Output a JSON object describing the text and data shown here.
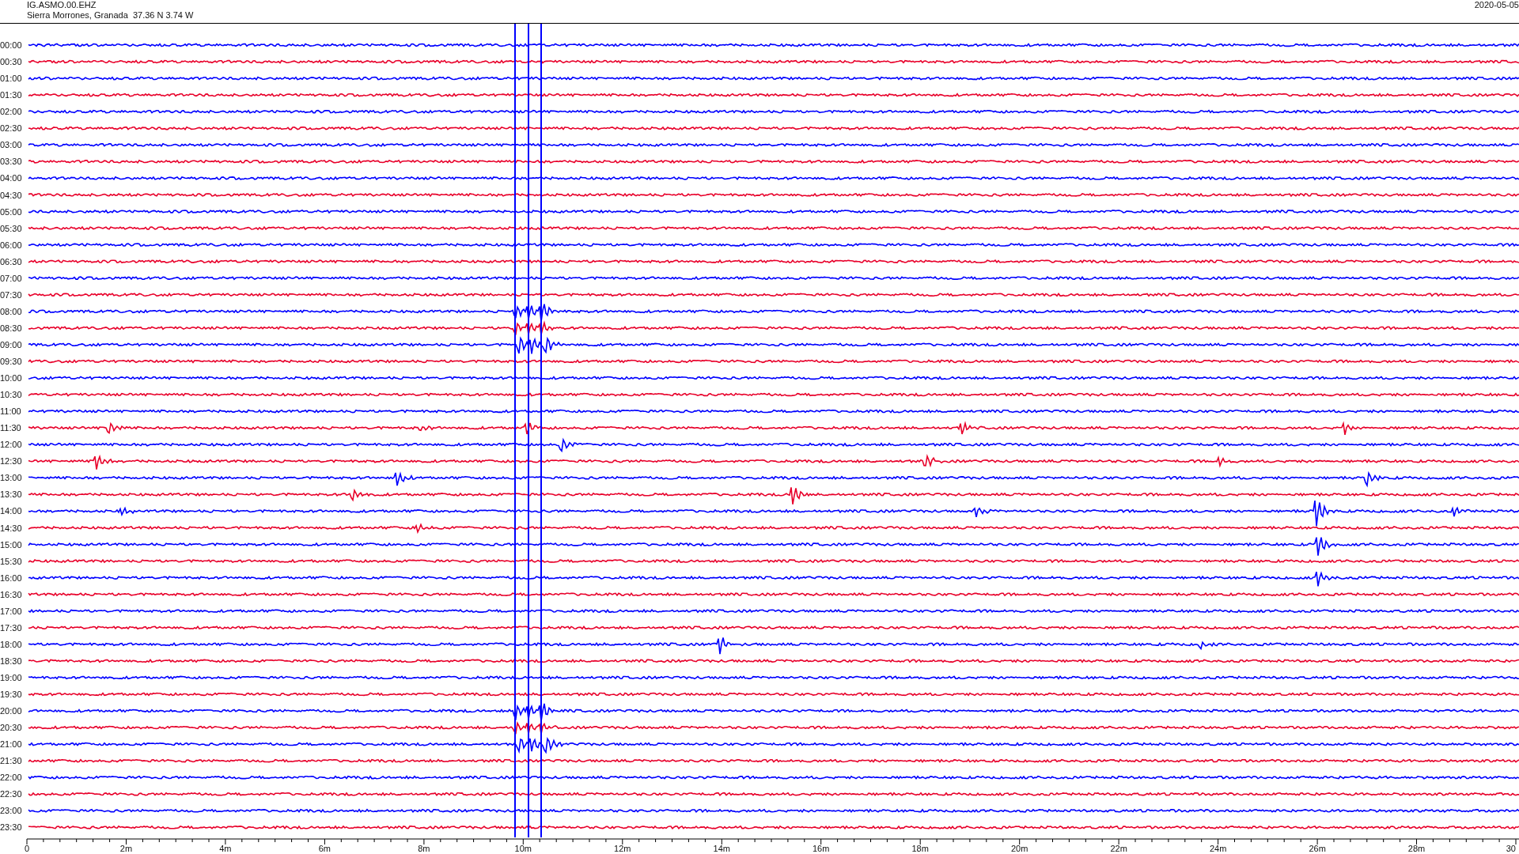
{
  "header": {
    "station": "IG.ASMO.00.EHZ",
    "location": "Sierra Morrones, Granada  37.36 N 3.74 W",
    "date": "2020-05-05"
  },
  "rows": [
    {
      "label": "00:00",
      "color": "#0000ff"
    },
    {
      "label": "00:30",
      "color": "#e8002a"
    },
    {
      "label": "01:00",
      "color": "#0000ff"
    },
    {
      "label": "01:30",
      "color": "#e8002a"
    },
    {
      "label": "02:00",
      "color": "#0000ff"
    },
    {
      "label": "02:30",
      "color": "#e8002a"
    },
    {
      "label": "03:00",
      "color": "#0000ff"
    },
    {
      "label": "03:30",
      "color": "#e8002a"
    },
    {
      "label": "04:00",
      "color": "#0000ff"
    },
    {
      "label": "04:30",
      "color": "#e8002a"
    },
    {
      "label": "05:00",
      "color": "#0000ff"
    },
    {
      "label": "05:30",
      "color": "#e8002a"
    },
    {
      "label": "06:00",
      "color": "#0000ff"
    },
    {
      "label": "06:30",
      "color": "#e8002a"
    },
    {
      "label": "07:00",
      "color": "#0000ff"
    },
    {
      "label": "07:30",
      "color": "#e8002a"
    },
    {
      "label": "08:00",
      "color": "#0000ff"
    },
    {
      "label": "08:30",
      "color": "#e8002a"
    },
    {
      "label": "09:00",
      "color": "#0000ff"
    },
    {
      "label": "09:30",
      "color": "#e8002a"
    },
    {
      "label": "10:00",
      "color": "#0000ff"
    },
    {
      "label": "10:30",
      "color": "#e8002a"
    },
    {
      "label": "11:00",
      "color": "#0000ff"
    },
    {
      "label": "11:30",
      "color": "#e8002a"
    },
    {
      "label": "12:00",
      "color": "#0000ff"
    },
    {
      "label": "12:30",
      "color": "#e8002a"
    },
    {
      "label": "13:00",
      "color": "#0000ff"
    },
    {
      "label": "13:30",
      "color": "#e8002a"
    },
    {
      "label": "14:00",
      "color": "#0000ff"
    },
    {
      "label": "14:30",
      "color": "#e8002a"
    },
    {
      "label": "15:00",
      "color": "#0000ff"
    },
    {
      "label": "15:30",
      "color": "#e8002a"
    },
    {
      "label": "16:00",
      "color": "#0000ff"
    },
    {
      "label": "16:30",
      "color": "#e8002a"
    },
    {
      "label": "17:00",
      "color": "#0000ff"
    },
    {
      "label": "17:30",
      "color": "#e8002a"
    },
    {
      "label": "18:00",
      "color": "#0000ff"
    },
    {
      "label": "18:30",
      "color": "#e8002a"
    },
    {
      "label": "19:00",
      "color": "#0000ff"
    },
    {
      "label": "19:30",
      "color": "#e8002a"
    },
    {
      "label": "20:00",
      "color": "#0000ff"
    },
    {
      "label": "20:30",
      "color": "#e8002a"
    },
    {
      "label": "21:00",
      "color": "#0000ff"
    },
    {
      "label": "21:30",
      "color": "#e8002a"
    },
    {
      "label": "22:00",
      "color": "#0000ff"
    },
    {
      "label": "22:30",
      "color": "#e8002a"
    },
    {
      "label": "23:00",
      "color": "#0000ff"
    },
    {
      "label": "23:30",
      "color": "#e8002a"
    }
  ],
  "time_axis": {
    "tick_labels": [
      "0",
      "2m",
      "4m",
      "6m",
      "8m",
      "10m",
      "12m",
      "14m",
      "16m",
      "18m",
      "20m",
      "22m",
      "24m",
      "26m",
      "28m",
      "30"
    ]
  }
}
